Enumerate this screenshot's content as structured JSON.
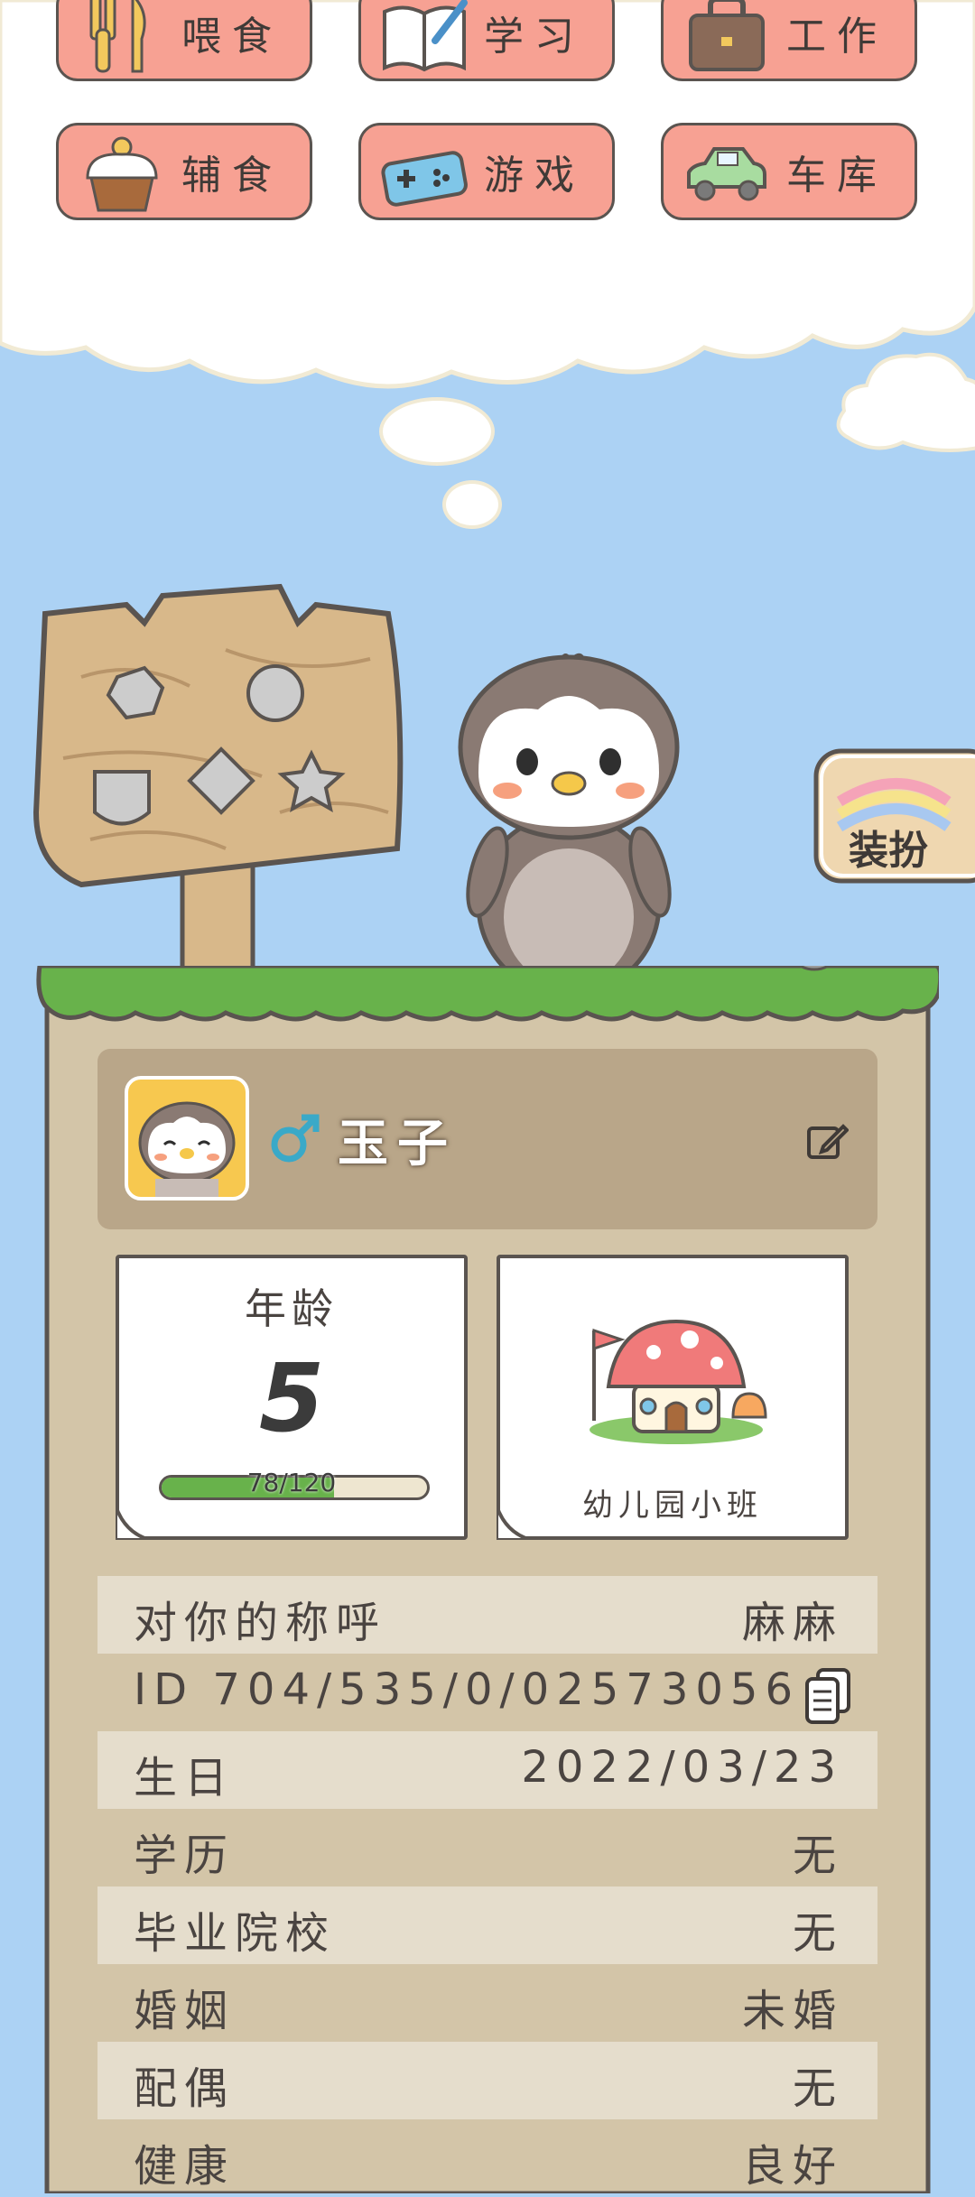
{
  "actions": {
    "row1": [
      {
        "label": "喂食",
        "icon": "fork-knife-icon"
      },
      {
        "label": "学习",
        "icon": "book-icon"
      },
      {
        "label": "工作",
        "icon": "briefcase-icon"
      }
    ],
    "row2": [
      {
        "label": "辅食",
        "icon": "cupcake-icon"
      },
      {
        "label": "游戏",
        "icon": "gamepad-icon"
      },
      {
        "label": "车库",
        "icon": "car-icon"
      }
    ]
  },
  "dress_button": {
    "label": "装扮"
  },
  "profile": {
    "name": "玉子",
    "gender": "male"
  },
  "age_card": {
    "label": "年龄",
    "value": "5",
    "progress_text": "78/120",
    "progress_fraction": 0.65
  },
  "school_card": {
    "label": "幼儿园小班"
  },
  "info_rows": [
    {
      "key": "对你的称呼",
      "value": "麻麻"
    },
    {
      "key": "ID",
      "value": "704/535/0/02573056"
    },
    {
      "key": "生日",
      "value": "2022/03/23"
    },
    {
      "key": "学历",
      "value": "无"
    },
    {
      "key": "毕业院校",
      "value": "无"
    },
    {
      "key": "婚姻",
      "value": "未婚"
    },
    {
      "key": "配偶",
      "value": "无"
    },
    {
      "key": "健康",
      "value": "良好"
    }
  ],
  "colors": {
    "sky": "#acd2f4",
    "button": "#f7a193",
    "panel": "#d3c5a8",
    "grass": "#68b24b"
  }
}
